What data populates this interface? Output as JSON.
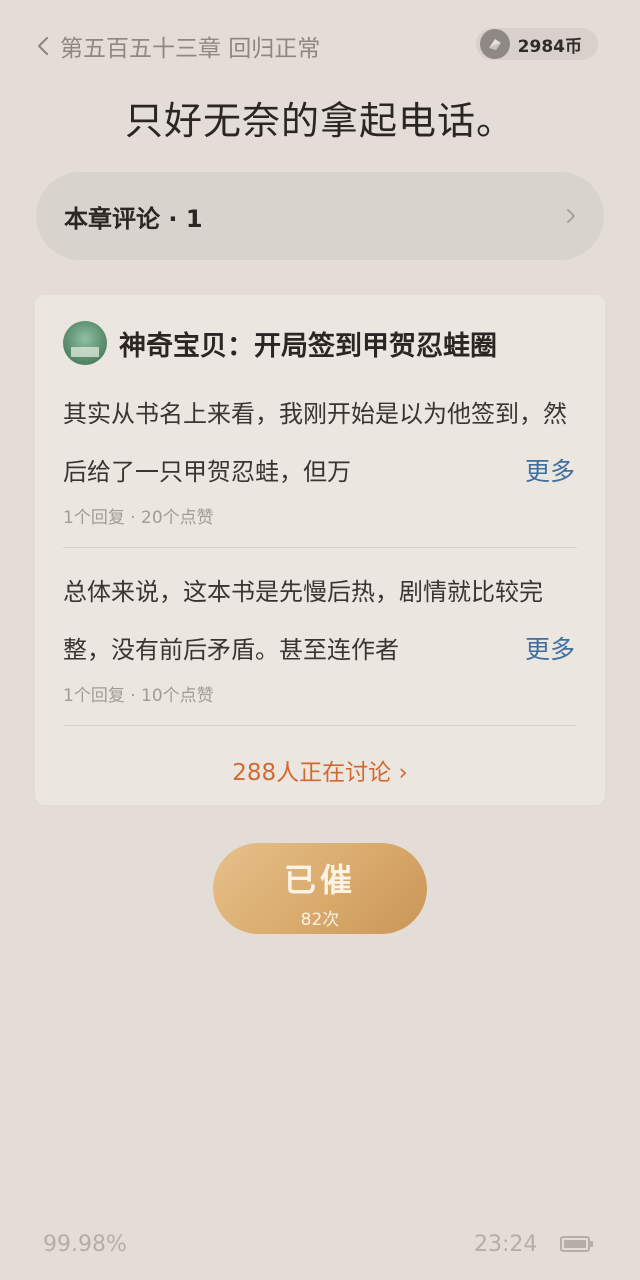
{
  "header": {
    "back_label": "第五百五十三章 回归正常",
    "coin_count": "2984币"
  },
  "chapter_title": "只好无奈的拿起电话。",
  "comments_section": {
    "label": "本章评论 · 1"
  },
  "book_card": {
    "book_title": "神奇宝贝：开局签到甲贺忍蛙圈",
    "reviews": [
      {
        "text": "其实从书名上来看，我刚开始是以为他签到，然后给了一只甲贺忍蛙，但万",
        "more_label": "更多",
        "meta": "1个回复 · 20个点赞"
      },
      {
        "text": "总体来说，这本书是先慢后热，剧情就比较完整，没有前后矛盾。甚至连作者",
        "more_label": "更多",
        "meta": "1个回复 · 10个点赞"
      }
    ],
    "discuss_label": "288人正在讨论 ›"
  },
  "urge_button": {
    "label": "已催",
    "count": "82次"
  },
  "status_bar": {
    "progress": "99.98%",
    "time": "23:24"
  },
  "colors": {
    "background": "#e4ddd7",
    "card": "#ece6e1",
    "link_blue": "#3f6f9e",
    "discuss_orange": "#d16a31",
    "urge_gold": "#d9aa6c"
  },
  "icons": {
    "back": "chevron-left-icon",
    "coin": "coin-icon",
    "comment_arrow": "chevron-right-icon",
    "battery": "battery-icon"
  }
}
